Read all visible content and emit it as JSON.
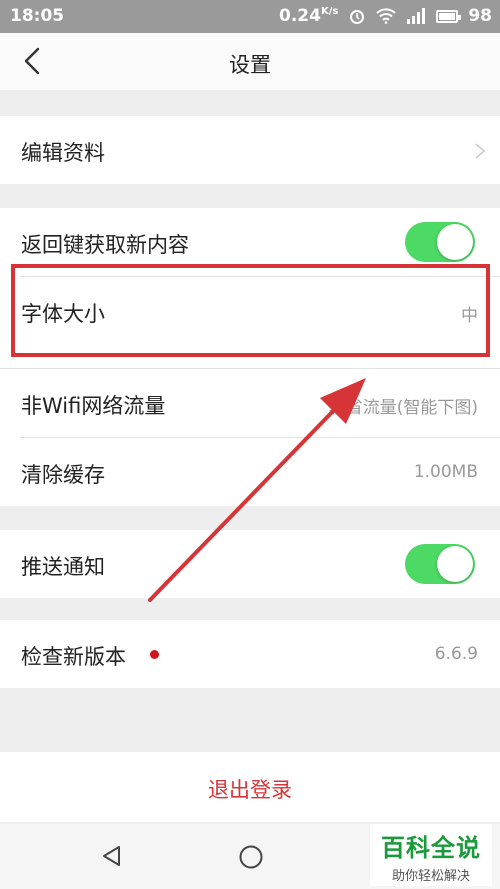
{
  "status_bar": {
    "time": "18:05",
    "net_speed": "0.24",
    "net_unit": "K/s",
    "battery": "98"
  },
  "header": {
    "title": "设置"
  },
  "settings": {
    "edit_profile": "编辑资料",
    "back_refresh": "返回键获取新内容",
    "back_refresh_on": true,
    "font_size_label": "字体大小",
    "font_size_value": "中",
    "non_wifi_label": "非Wifi网络流量",
    "non_wifi_value": "较省流量(智能下图)",
    "clear_cache_label": "清除缓存",
    "clear_cache_value": "1.00MB",
    "push_label": "推送通知",
    "push_on": true,
    "check_version_label": "检查新版本",
    "version_value": "6.6.9"
  },
  "logout": {
    "label": "退出登录"
  },
  "watermark": {
    "title": "百科全说",
    "subtitle": "助你轻松解决"
  },
  "colors": {
    "toggle_on": "#4cd964",
    "highlight": "#d63437",
    "logout_text": "#d63437",
    "badge": "#d0141a"
  }
}
